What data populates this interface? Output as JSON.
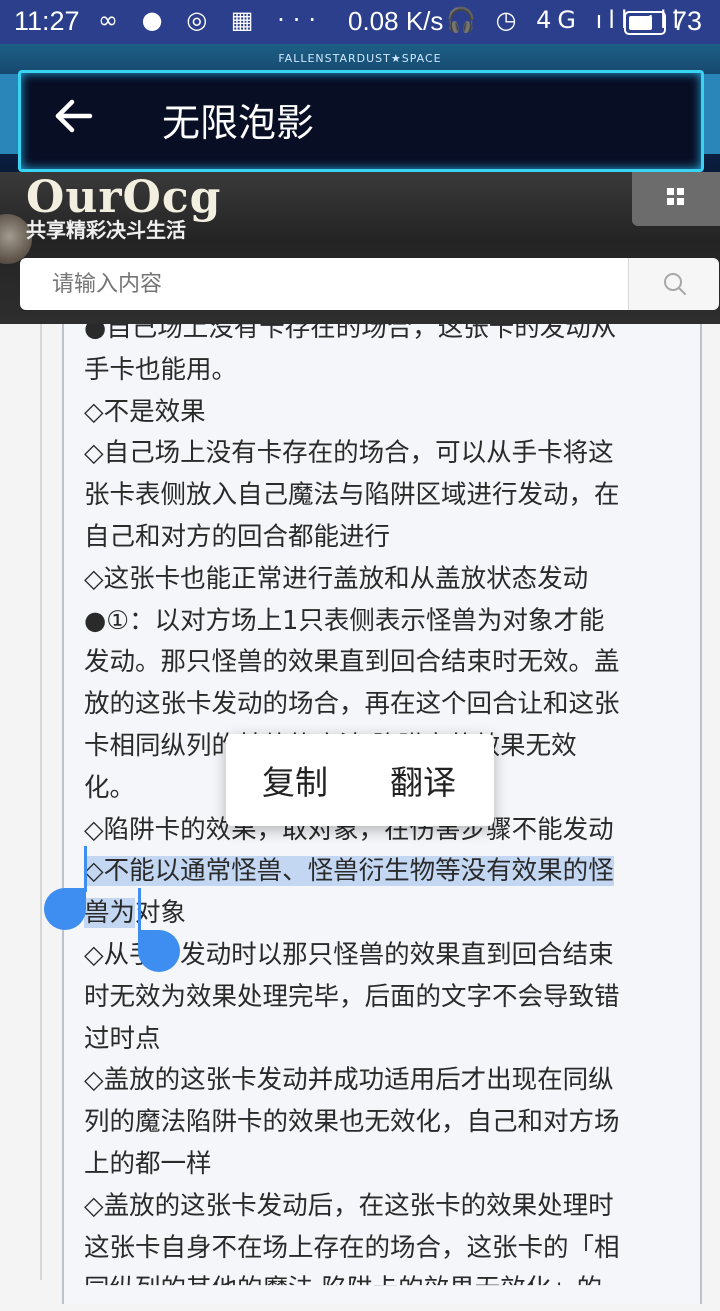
{
  "status_bar": {
    "time": "11:27",
    "notif_icons": "∞ ● ◎ ▦ ···",
    "net_speed": "0.08 K/s",
    "right_icons": "🎧 ◷ 4G ıll ıll",
    "battery": "73",
    "battery_level": 0.73
  },
  "toolbar": {
    "banner_tag": "FALLENSTARDUST★SPACE",
    "title": "无限泡影"
  },
  "site": {
    "logo": "OurOcg",
    "tagline": "共享精彩决斗生活",
    "search_placeholder": "请输入内容"
  },
  "article": {
    "lines": [
      "●自己场上没有卡存在的场合，这张卡的发动从",
      "手卡也能用。",
      "◇不是效果",
      "◇自己场上没有卡存在的场合，可以从手卡将这",
      "张卡表侧放入自己魔法与陷阱区域进行发动，在",
      "自己和对方的回合都能进行",
      "◇这张卡也能正常进行盖放和从盖放状态发动",
      "●①：以对方场上1只表侧表示怪兽为对象才能",
      "发动。那只怪兽的效果直到回合结束时无效。盖",
      "放的这张卡发动的场合，再在这个回合让和这张",
      "卡相同纵列的其他的魔法·陷阱卡的效果无效",
      "化。",
      "◇陷阱卡的效果，取对象，在伤害步骤不能发动",
      "◇不能以通常怪兽、怪兽衍生物等没有效果的怪",
      "兽为对象",
      "◇从手卡发动时以那只怪兽的效果直到回合结束",
      "时无效为效果处理完毕，后面的文字不会导致错",
      "过时点",
      "◇盖放的这张卡发动并成功适用后才出现在同纵",
      "列的魔法陷阱卡的效果也无效化，自己和对方场",
      "上的都一样",
      "◇盖放的这张卡发动后，在这张卡的效果处理时",
      "这张卡自身不在场上存在的场合，这张卡的「相",
      "同纵列的其他的魔法·陷阱卡的效果无效化」的"
    ],
    "highlight_a": "◇不能以通常怪兽、怪兽衍生物等没有效果的怪",
    "highlight_b": "兽为",
    "after_highlight_b": "对象"
  },
  "context_menu": {
    "copy": "复制",
    "translate": "翻译"
  },
  "colors": {
    "status_bar": "#2b3f8c",
    "toolbar_frame": "#3ad4f3",
    "selection": "#c3d7f3",
    "handle": "#3d8ef0"
  }
}
